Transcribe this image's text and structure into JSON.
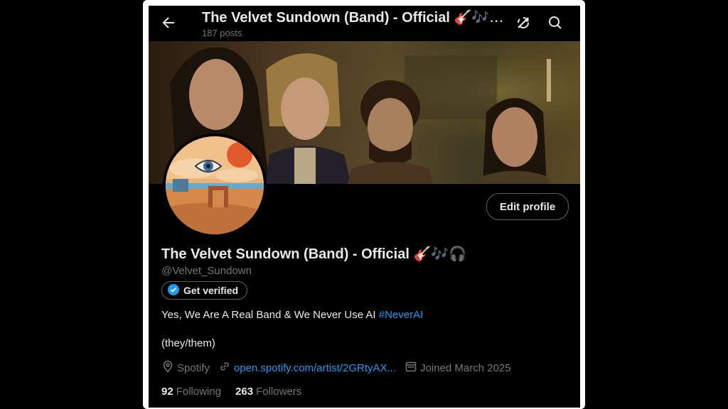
{
  "header": {
    "title": "The Velvet Sundown (Band) - Official",
    "title_emoji": "🎸🎶…",
    "post_count": "187 posts",
    "icons": [
      "back-arrow-icon",
      "sync-off-icon",
      "search-icon"
    ]
  },
  "profile": {
    "display_name": "The Velvet Sundown (Band) - Official",
    "name_emoji": "🎸🎶🎧",
    "handle": "@Velvet_Sundown",
    "edit_button": "Edit profile",
    "verify_button": "Get verified",
    "bio_text": "Yes, We Are A Real Band & We Never Use AI ",
    "bio_hashtag": "#NeverAI",
    "pronouns": "(they/them)",
    "location": "Spotify",
    "website": "open.spotify.com/artist/2GRtyAX...",
    "joined": "Joined March 2025",
    "following_count": "92",
    "following_label": "Following",
    "followers_count": "263",
    "followers_label": "Followers"
  },
  "colors": {
    "background": "#000000",
    "text_primary": "#e7e9ea",
    "text_secondary": "#71767b",
    "accent": "#1d9bf0",
    "border": "#536471"
  }
}
